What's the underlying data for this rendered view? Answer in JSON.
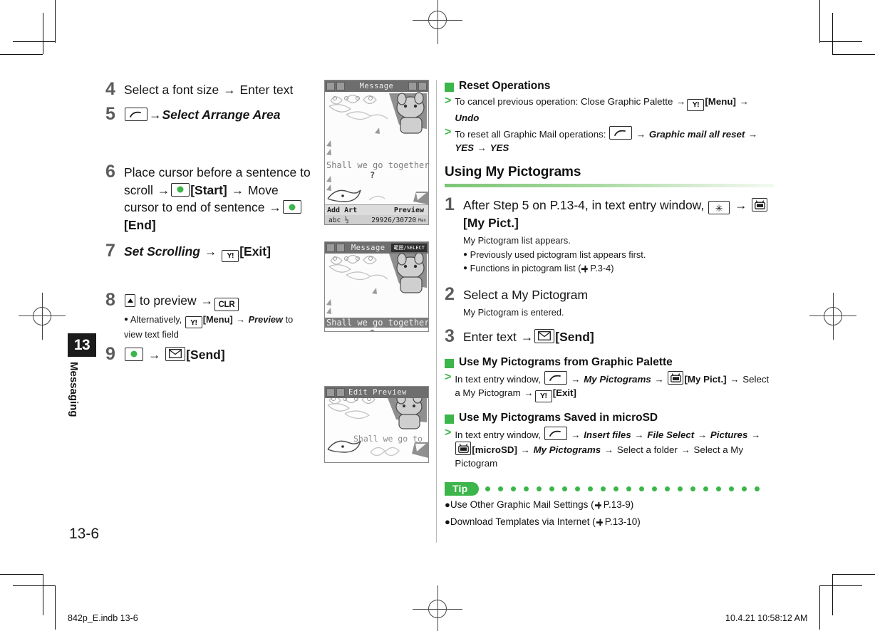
{
  "page": {
    "number": "13-6",
    "chapter_number": "13",
    "chapter_label": "Messaging"
  },
  "footer": {
    "file": "842p_E.indb   13-6",
    "timestamp": "10.4.21   10:58:12 AM"
  },
  "left_column": {
    "steps": [
      {
        "num": "4",
        "parts": [
          {
            "t": "text",
            "v": "Select a font size "
          },
          {
            "t": "arrow",
            "v": "→"
          },
          {
            "t": "text",
            "v": " Enter text"
          }
        ]
      },
      {
        "num": "5",
        "parts": [
          {
            "t": "key",
            "v": "soft-key-icon"
          },
          {
            "t": "arrow",
            "v": "→"
          },
          {
            "t": "italicbold",
            "v": "Select Arrange Area"
          }
        ]
      },
      {
        "num": "6",
        "parts": [
          {
            "t": "text",
            "v": "Place cursor before a sentence to scroll "
          },
          {
            "t": "arrow",
            "v": "→"
          },
          {
            "t": "key",
            "v": "center-key-icon"
          },
          {
            "t": "bold",
            "v": "[Start]"
          },
          {
            "t": "arrow",
            "v": " →"
          },
          {
            "t": "text",
            "v": " Move cursor to end of sentence "
          },
          {
            "t": "arrow",
            "v": "→"
          },
          {
            "t": "key",
            "v": "center-key-icon"
          },
          {
            "t": "bold",
            "v": "[End]"
          }
        ]
      },
      {
        "num": "7",
        "parts": [
          {
            "t": "italicbold",
            "v": "Set Scrolling"
          },
          {
            "t": "arrow",
            "v": " → "
          },
          {
            "t": "key",
            "v": "yahoo-key-icon"
          },
          {
            "t": "bold",
            "v": "[Exit]"
          }
        ]
      },
      {
        "num": "8",
        "parts": [
          {
            "t": "key",
            "v": "up-arrow-key-icon"
          },
          {
            "t": "text",
            "v": " to preview "
          },
          {
            "t": "arrow",
            "v": "→"
          },
          {
            "t": "key",
            "v": "clr-key-icon"
          }
        ],
        "notes": [
          {
            "parts": [
              {
                "t": "bullet",
                "v": "●"
              },
              {
                "t": "text",
                "v": " Alternatively, "
              },
              {
                "t": "key",
                "v": "yahoo-key-icon"
              },
              {
                "t": "bold",
                "v": "[Menu]"
              },
              {
                "t": "arrow",
                "v": " → "
              },
              {
                "t": "italicbold",
                "v": "Preview"
              },
              {
                "t": "text",
                "v": " to view text field"
              }
            ]
          }
        ]
      },
      {
        "num": "9",
        "parts": [
          {
            "t": "key",
            "v": "center-key-icon"
          },
          {
            "t": "arrow",
            "v": " → "
          },
          {
            "t": "key",
            "v": "send-key-icon"
          },
          {
            "t": "bold",
            "v": "[Send]"
          }
        ]
      }
    ]
  },
  "screenshots": [
    {
      "name": "message-compose-screen",
      "title": "Message",
      "text_lines": [
        "Shall we go together",
        "?"
      ],
      "softkeys": {
        "left": "Add Art",
        "right": "Preview"
      },
      "status": {
        "left": "abc ½",
        "right": "29926/30720"
      },
      "status_unit": "Max"
    },
    {
      "name": "message-select-screen",
      "title": "Message",
      "badge": "範囲/SELECT",
      "text_lines": [
        "Shall we go together",
        "?"
      ]
    },
    {
      "name": "edit-preview-screen",
      "title": "Edit Preview",
      "text_lines": [
        "Shall we go to"
      ]
    }
  ],
  "right_column": {
    "reset_operations": {
      "heading": "Reset Operations",
      "items": [
        {
          "parts": [
            {
              "t": "text",
              "v": "To cancel previous operation: Close Graphic Palette "
            },
            {
              "t": "arrow",
              "v": "→"
            },
            {
              "t": "key",
              "v": "yahoo-key-icon"
            },
            {
              "t": "bold",
              "v": "[Menu]"
            },
            {
              "t": "arrow",
              "v": " → "
            },
            {
              "t": "italicbold",
              "v": "Undo"
            }
          ]
        },
        {
          "parts": [
            {
              "t": "text",
              "v": "To reset all Graphic Mail operations: "
            },
            {
              "t": "key",
              "v": "soft-key-icon"
            },
            {
              "t": "arrow",
              "v": " → "
            },
            {
              "t": "italicbold",
              "v": "Graphic mail all reset"
            },
            {
              "t": "arrow",
              "v": " → "
            },
            {
              "t": "italicbold",
              "v": "YES"
            },
            {
              "t": "arrow",
              "v": " → "
            },
            {
              "t": "italicbold",
              "v": "YES"
            }
          ]
        }
      ]
    },
    "section": {
      "title": "Using My Pictograms",
      "steps": [
        {
          "num": "1",
          "parts": [
            {
              "t": "text",
              "v": "After Step 5 on P.13-4, in text entry window, "
            },
            {
              "t": "key",
              "v": "star-key-icon"
            },
            {
              "t": "arrow",
              "v": " → "
            },
            {
              "t": "key",
              "v": "tv-key-icon"
            },
            {
              "t": "bold",
              "v": "[My Pict.]"
            }
          ],
          "notes": [
            {
              "parts": [
                {
                  "t": "text",
                  "v": "My Pictogram list appears."
                }
              ]
            },
            {
              "parts": [
                {
                  "t": "bullet",
                  "v": "●"
                },
                {
                  "t": "text",
                  "v": " Previously used pictogram list appears first."
                }
              ]
            },
            {
              "parts": [
                {
                  "t": "bullet",
                  "v": "●"
                },
                {
                  "t": "text",
                  "v": " Functions in pictogram list ("
                },
                {
                  "t": "hand",
                  "v": "ref-hand-icon"
                },
                {
                  "t": "text",
                  "v": "P.3-4)"
                }
              ]
            }
          ]
        },
        {
          "num": "2",
          "parts": [
            {
              "t": "text",
              "v": "Select a My Pictogram"
            }
          ],
          "notes": [
            {
              "parts": [
                {
                  "t": "text",
                  "v": "My Pictogram is entered."
                }
              ]
            }
          ]
        },
        {
          "num": "3",
          "parts": [
            {
              "t": "text",
              "v": "Enter text "
            },
            {
              "t": "arrow",
              "v": "→"
            },
            {
              "t": "key",
              "v": "send-key-icon"
            },
            {
              "t": "bold",
              "v": "[Send]"
            }
          ]
        }
      ]
    },
    "graphic_palette": {
      "heading": "Use My Pictograms from Graphic Palette",
      "items": [
        {
          "parts": [
            {
              "t": "text",
              "v": "In text entry window, "
            },
            {
              "t": "key",
              "v": "soft-key-icon"
            },
            {
              "t": "arrow",
              "v": " → "
            },
            {
              "t": "italicbold",
              "v": "My Pictograms"
            },
            {
              "t": "arrow",
              "v": " → "
            },
            {
              "t": "key",
              "v": "tv-key-icon"
            },
            {
              "t": "bold",
              "v": "[My Pict.]"
            },
            {
              "t": "arrow",
              "v": " → "
            },
            {
              "t": "text",
              "v": "Select a My Pictogram "
            },
            {
              "t": "arrow",
              "v": "→"
            },
            {
              "t": "key",
              "v": "yahoo-key-icon"
            },
            {
              "t": "bold",
              "v": "[Exit]"
            }
          ]
        }
      ]
    },
    "microsd": {
      "heading": "Use My Pictograms Saved in microSD",
      "items": [
        {
          "parts": [
            {
              "t": "text",
              "v": "In text entry window, "
            },
            {
              "t": "key",
              "v": "soft-key-icon"
            },
            {
              "t": "arrow",
              "v": " → "
            },
            {
              "t": "italicbold",
              "v": "Insert files"
            },
            {
              "t": "arrow",
              "v": " → "
            },
            {
              "t": "italicbold",
              "v": "File Select"
            },
            {
              "t": "arrow",
              "v": " → "
            },
            {
              "t": "italicbold",
              "v": "Pictures"
            },
            {
              "t": "arrow",
              "v": " → "
            },
            {
              "t": "key",
              "v": "tv-key-icon"
            },
            {
              "t": "bold",
              "v": "[microSD]"
            },
            {
              "t": "arrow",
              "v": " → "
            },
            {
              "t": "italicbold",
              "v": "My Pictograms"
            },
            {
              "t": "arrow",
              "v": " → "
            },
            {
              "t": "text",
              "v": "Select a folder "
            },
            {
              "t": "arrow",
              "v": "→"
            },
            {
              "t": "text",
              "v": " Select a My Pictogram"
            }
          ]
        }
      ]
    },
    "tip": {
      "label": "Tip",
      "dot_count": 22,
      "items": [
        {
          "bullet": "●",
          "text": "Use Other Graphic Mail Settings (",
          "ref": "P.13-9",
          "close": ")"
        },
        {
          "bullet": "●",
          "text": "Download Templates via Internet (",
          "ref": "P.13-10",
          "close": ")"
        }
      ]
    }
  },
  "colors": {
    "accent_green": "#3cb54a",
    "rule_green": "#7cc576",
    "step_number_gray": "#5c5c5c",
    "chapter_tab_black": "#1b1b1b"
  }
}
